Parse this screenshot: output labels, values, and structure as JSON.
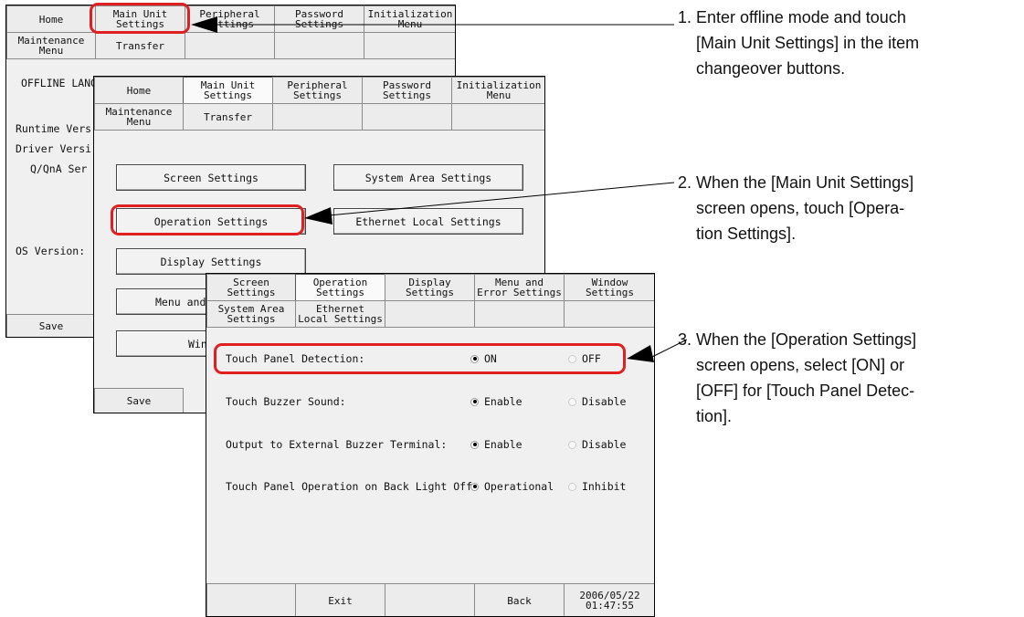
{
  "screen1": {
    "row1": [
      "Home",
      "Main Unit\nSettings",
      "Peripheral\nSettings",
      "Password\nSettings",
      "Initialization\nMenu"
    ],
    "row2": [
      "Maintenance\nMenu",
      "Transfer"
    ],
    "labels": {
      "offline_lang": "OFFLINE LANG",
      "runtime": "Runtime Vers",
      "driver": "Driver Versi",
      "qna": "Q/QnA Ser",
      "os": "OS Version:"
    },
    "save": "Save"
  },
  "screen2": {
    "row1": [
      "Home",
      "Main Unit\nSettings",
      "Peripheral\nSettings",
      "Password\nSettings",
      "Initialization\nMenu"
    ],
    "row2": [
      "Maintenance\nMenu",
      "Transfer"
    ],
    "buttons": {
      "screen_settings": "Screen Settings",
      "system_area": "System Area Settings",
      "operation": "Operation Settings",
      "ethernet": "Ethernet Local Settings",
      "display": "Display Settings",
      "menu_partial": "Menu and E",
      "window_partial": "Window"
    },
    "save": "Save"
  },
  "screen3": {
    "row1": [
      "Screen\nSettings",
      "Operation\nSettings",
      "Display\nSettings",
      "Menu and\nError Settings",
      "Window\nSettings"
    ],
    "row2": [
      "System Area\nSettings",
      "Ethernet\nLocal Settings"
    ],
    "settings": [
      {
        "label": "Touch Panel Detection:",
        "opt1": "ON",
        "opt2": "OFF"
      },
      {
        "label": "Touch Buzzer Sound:",
        "opt1": "Enable",
        "opt2": "Disable"
      },
      {
        "label": "Output to External Buzzer Terminal:",
        "opt1": "Enable",
        "opt2": "Disable"
      },
      {
        "label": "Touch Panel Operation on Back Light Off:",
        "opt1": "Operational",
        "opt2": "Inhibit"
      }
    ],
    "bottom": {
      "exit": "Exit",
      "back": "Back",
      "date": "2006/05/22",
      "time": "01:47:55"
    }
  },
  "steps": [
    {
      "num": "1.",
      "line1": "Enter offline mode and touch",
      "line2": "[Main Unit Settings] in the item",
      "line3": "changeover buttons."
    },
    {
      "num": "2.",
      "line1": "When the [Main Unit Settings]",
      "line2": "screen opens, touch [Opera-",
      "line3": "tion Settings]."
    },
    {
      "num": "3.",
      "line1": "When the [Operation Settings]",
      "line2": "screen opens, select [ON] or",
      "line3": "[OFF] for [Touch Panel Detec-",
      "line4": "tion]."
    }
  ],
  "colors": {
    "highlight": "#e02020",
    "screen_bg": "#f0f0f0"
  }
}
